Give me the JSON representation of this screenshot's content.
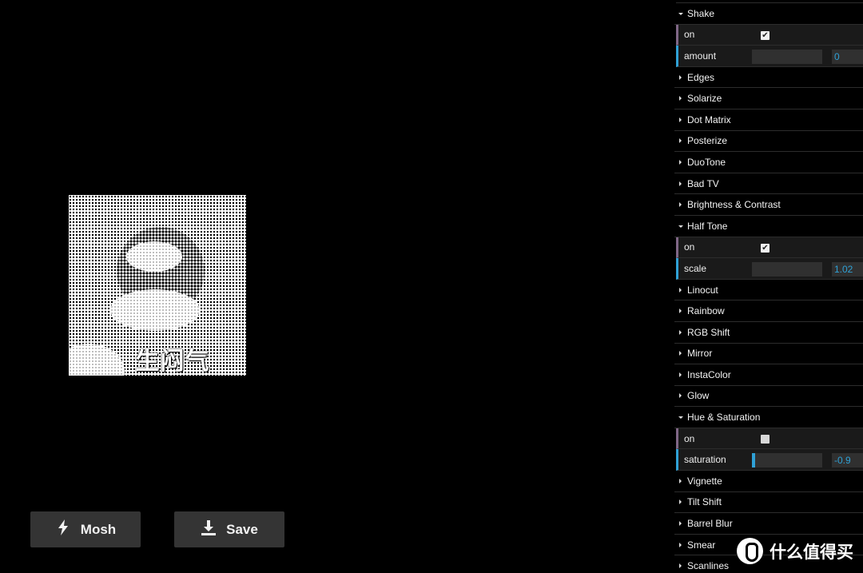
{
  "preview": {
    "caption": "生闷气"
  },
  "buttons": {
    "mosh_label": "Mosh",
    "mosh_icon": "bolt-icon",
    "save_label": "Save",
    "save_icon": "download-icon"
  },
  "panel": {
    "items": [
      {
        "type": "folder",
        "label": "Shake",
        "open": true
      },
      {
        "type": "bool",
        "label": "on",
        "checked": true
      },
      {
        "type": "number",
        "label": "amount",
        "value": "0",
        "fraction": 0
      },
      {
        "type": "folder",
        "label": "Edges",
        "open": false
      },
      {
        "type": "folder",
        "label": "Solarize",
        "open": false
      },
      {
        "type": "folder",
        "label": "Dot Matrix",
        "open": false
      },
      {
        "type": "folder",
        "label": "Posterize",
        "open": false
      },
      {
        "type": "folder",
        "label": "DuoTone",
        "open": false
      },
      {
        "type": "folder",
        "label": "Bad TV",
        "open": false
      },
      {
        "type": "folder",
        "label": "Brightness & Contrast",
        "open": false
      },
      {
        "type": "folder",
        "label": "Half Tone",
        "open": true
      },
      {
        "type": "bool",
        "label": "on",
        "checked": true
      },
      {
        "type": "number",
        "label": "scale",
        "value": "1.02",
        "fraction": 0
      },
      {
        "type": "folder",
        "label": "Linocut",
        "open": false
      },
      {
        "type": "folder",
        "label": "Rainbow",
        "open": false
      },
      {
        "type": "folder",
        "label": "RGB Shift",
        "open": false
      },
      {
        "type": "folder",
        "label": "Mirror",
        "open": false
      },
      {
        "type": "folder",
        "label": "InstaColor",
        "open": false
      },
      {
        "type": "folder",
        "label": "Glow",
        "open": false
      },
      {
        "type": "folder",
        "label": "Hue & Saturation",
        "open": true
      },
      {
        "type": "bool",
        "label": "on",
        "checked": false
      },
      {
        "type": "number",
        "label": "saturation",
        "value": "-0.9",
        "fraction": 0.05
      },
      {
        "type": "folder",
        "label": "Vignette",
        "open": false
      },
      {
        "type": "folder",
        "label": "Tilt Shift",
        "open": false
      },
      {
        "type": "folder",
        "label": "Barrel Blur",
        "open": false
      },
      {
        "type": "folder",
        "label": "Smear",
        "open": false
      },
      {
        "type": "folder",
        "label": "Scanlines",
        "open": false
      }
    ]
  },
  "watermark": {
    "text": "什么值得买",
    "icon": "smzdm-logo-icon"
  },
  "colors": {
    "background": "#000000",
    "button": "#343434",
    "bool_accent": "#806787",
    "number_accent": "#2fa1d6",
    "control_bg": "#1a1a1a",
    "field_bg": "#303030"
  }
}
